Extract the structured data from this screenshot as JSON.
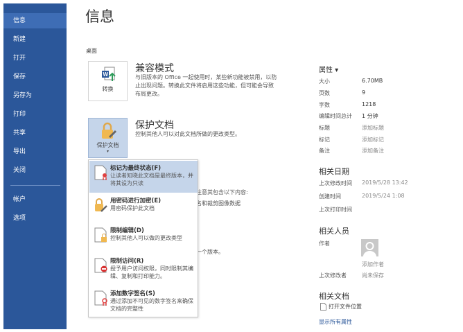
{
  "sidebar": {
    "items": [
      {
        "label": "信息"
      },
      {
        "label": "新建"
      },
      {
        "label": "打开"
      },
      {
        "label": "保存"
      },
      {
        "label": "另存为"
      },
      {
        "label": "打印"
      },
      {
        "label": "共享"
      },
      {
        "label": "导出"
      },
      {
        "label": "关闭"
      },
      {
        "label": "帐户"
      },
      {
        "label": "选项"
      }
    ]
  },
  "main": {
    "title": "信息",
    "location": "桌面",
    "compat": {
      "button": "转换",
      "title": "兼容模式",
      "desc": [
        "与旧版本的 Office 一起使用时，某些新功能被禁用，以防",
        "止出现问题。转换此文件将启用这些功能，但可能会导致",
        "布局更改。"
      ]
    },
    "protect": {
      "button": "保护文档",
      "title": "保护文档",
      "desc": "控制其他人可以对此文档所做的更改类型。"
    },
    "hidden_text": [
      "注意其包含以下内容:",
      "名和裁剪图像数据",
      "一个版本。"
    ],
    "menu": [
      {
        "title": "标记为最终状态(F)",
        "desc": "让读者知晓此文档是最终版本，并将其设为只读"
      },
      {
        "title": "用密码进行加密(E)",
        "desc": "用密码保护此文档"
      },
      {
        "title": "限制编辑(D)",
        "desc": "控制其他人可以做的更改类型"
      },
      {
        "title": "限制访问(R)",
        "desc": "授予用户访问权限，同时限制其编辑、复制和打印能力。"
      },
      {
        "title": "添加数字签名(S)",
        "desc": "通过添加不可见的数字签名来确保文档的完整性"
      }
    ]
  },
  "properties": {
    "title": "属性 ▾",
    "rows": [
      {
        "label": "大小",
        "value": "6.70MB"
      },
      {
        "label": "页数",
        "value": "9"
      },
      {
        "label": "字数",
        "value": "1218"
      },
      {
        "label": "编辑时间总计",
        "value": "1 分钟"
      },
      {
        "label": "标题",
        "value": "添加标题"
      },
      {
        "label": "标记",
        "value": "添加标记"
      },
      {
        "label": "备注",
        "value": "添加备注"
      }
    ],
    "dates_title": "相关日期",
    "dates": [
      {
        "label": "上次修改时间",
        "value": "2019/5/28 13:42"
      },
      {
        "label": "创建时间",
        "value": "2019/5/24 1:08"
      },
      {
        "label": "上次打印时间",
        "value": ""
      }
    ],
    "people_title": "相关人员",
    "author_label": "作者",
    "add_author": "添加作者",
    "last_modified_label": "上次修改者",
    "last_modified_value": "尚未保存",
    "docs_title": "相关文档",
    "open_location": "打开文件位置",
    "show_all": "显示所有属性"
  },
  "colors": {
    "sidebar": "#2b579a",
    "highlight": "#c5d5ea",
    "link": "#2b579a"
  }
}
